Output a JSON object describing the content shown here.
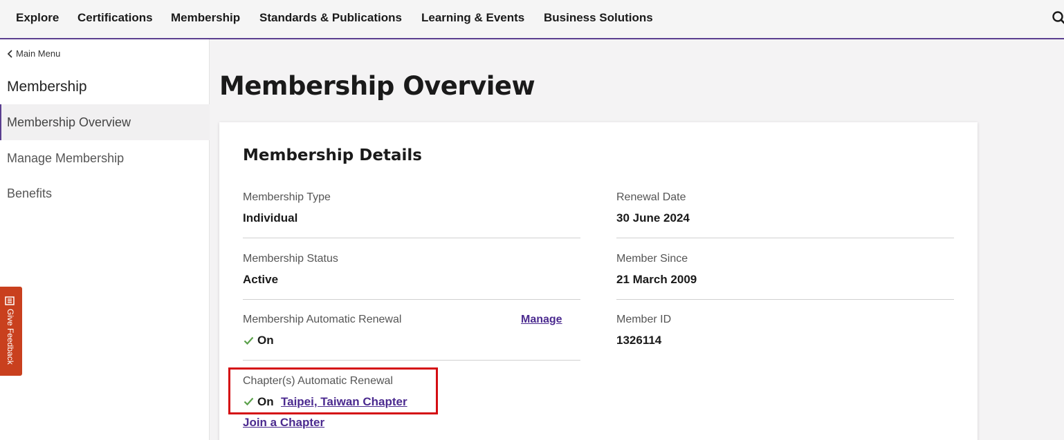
{
  "nav": {
    "items": [
      "Explore",
      "Certifications",
      "Membership",
      "Standards & Publications",
      "Learning & Events",
      "Business Solutions"
    ]
  },
  "sidebar": {
    "back_label": "Main Menu",
    "title": "Membership",
    "items": [
      {
        "label": "Membership Overview",
        "active": true
      },
      {
        "label": "Manage Membership",
        "active": false
      },
      {
        "label": "Benefits",
        "active": false
      }
    ]
  },
  "feedback": {
    "label": "Give Feedback"
  },
  "page": {
    "title": "Membership Overview",
    "card": {
      "title": "Membership Details",
      "membership_type": {
        "label": "Membership Type",
        "value": "Individual"
      },
      "membership_status": {
        "label": "Membership Status",
        "value": "Active"
      },
      "auto_renewal": {
        "label": "Membership Automatic Renewal",
        "value": "On",
        "manage_label": "Manage"
      },
      "chapter_renewal": {
        "label": "Chapter(s) Automatic Renewal",
        "value": "On",
        "chapter_link": "Taipei, Taiwan Chapter"
      },
      "join_chapter": "Join a Chapter",
      "renewal_date": {
        "label": "Renewal Date",
        "value": "30 June 2024"
      },
      "member_since": {
        "label": "Member Since",
        "value": "21 March 2009"
      },
      "member_id": {
        "label": "Member ID",
        "value": "1326114"
      }
    }
  },
  "colors": {
    "accent": "#5a3e8f",
    "link": "#4b2a8f",
    "check": "#5aa04a",
    "feedback": "#c9401e",
    "highlight": "#d40d12"
  }
}
